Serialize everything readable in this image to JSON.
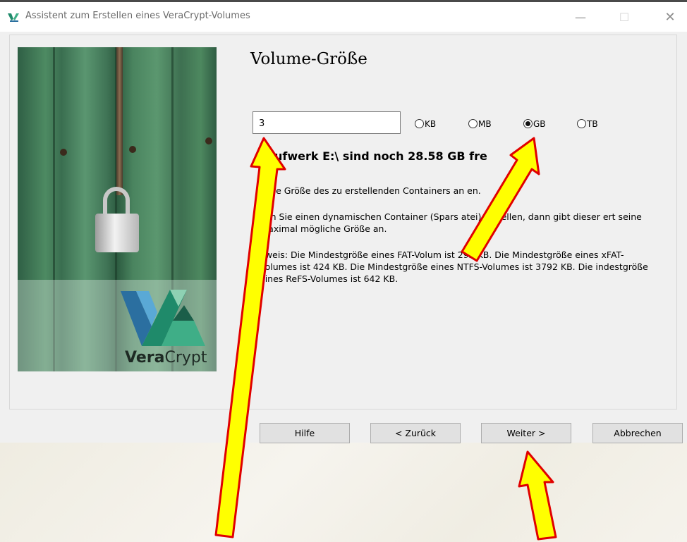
{
  "window": {
    "title": "Assistent zum Erstellen eines VeraCrypt-Volumes",
    "minimize_glyph": "—",
    "maximize_glyph": "☐",
    "close_glyph": "✕"
  },
  "branding": {
    "logo_bold": "Vera",
    "logo_regular": "Crypt",
    "logo_colors": [
      "#1f8a6a",
      "#3fae87",
      "#8ed1b3",
      "#2b6fa0"
    ]
  },
  "page": {
    "title": "Volume-Größe",
    "size_value": "3",
    "units": [
      {
        "label": "KB",
        "selected": false
      },
      {
        "label": "MB",
        "selected": false
      },
      {
        "label": "GB",
        "selected": true
      },
      {
        "label": "TB",
        "selected": false
      }
    ],
    "free_space": "Laufwerk E:\\ sind noch 28.58 GB fre",
    "info_line_1": "e die Größe des zu erstellenden Containers an     en.",
    "info_line_2": "enn Sie einen dynamischen Container (Spars     atei) erstellen, dann gibt dieser ert seine maximal mögliche Größe an.",
    "info_line_3": "nweis: Die Mindestgröße eines FAT-Volum    ist 292 KB. Die Mindestgröße eines xFAT-Volumes ist 424 KB. Die Mindestgröße eines NTFS-Volumes ist 3792 KB. Die indestgröße eines ReFS-Volumes ist 642 KB."
  },
  "buttons": {
    "help": "Hilfe",
    "back": "< Zurück",
    "next": "Weiter >",
    "cancel": "Abbrechen"
  },
  "annotation": {
    "arrow_fill": "#ffff00",
    "arrow_outline": "#e00000"
  }
}
